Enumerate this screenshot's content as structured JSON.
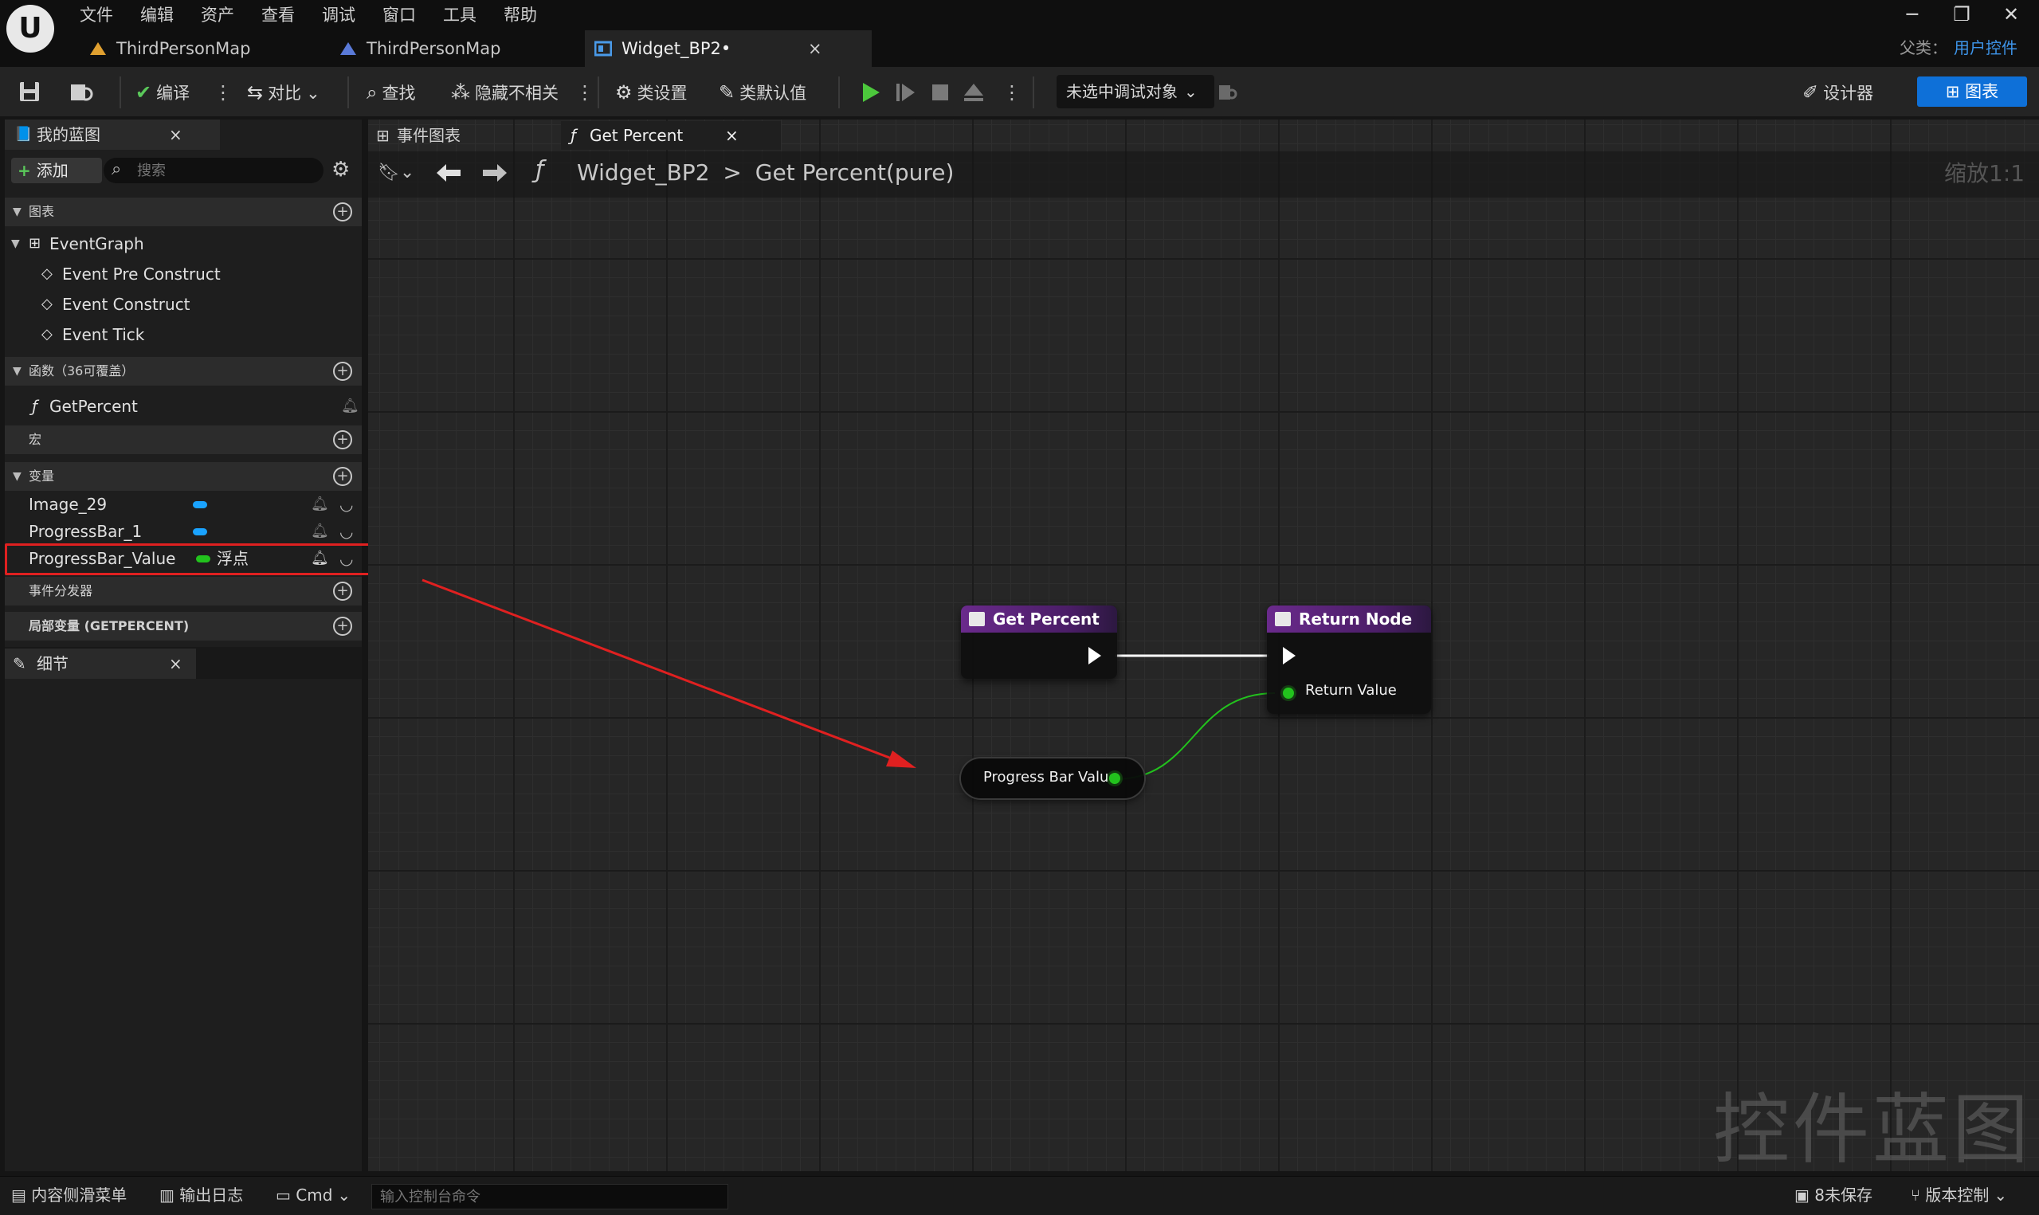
{
  "menu": [
    "文件",
    "编辑",
    "资产",
    "查看",
    "调试",
    "窗口",
    "工具",
    "帮助"
  ],
  "tabs": [
    {
      "label": "ThirdPersonMap"
    },
    {
      "label": "ThirdPersonMap"
    },
    {
      "label": "Widget_BP2•",
      "close": "×"
    }
  ],
  "window": {
    "minimize": "─",
    "restore": "❐",
    "close": "✕"
  },
  "parent_class": {
    "label": "父类：",
    "value": "用户控件"
  },
  "toolbar": {
    "compile": "编译",
    "diff": "对比",
    "find": "查找",
    "hide_unrelated": "隐藏不相关",
    "class_settings": "类设置",
    "class_defaults": "类默认值",
    "debug_select": "未选中调试对象",
    "designer": "设计器",
    "graph": "图表"
  },
  "my_blueprint": {
    "tab_label": "我的蓝图",
    "close": "×",
    "add_label": "添加",
    "search_placeholder": "搜索",
    "sections": {
      "graphs": "图表",
      "functions": "函数（36可覆盖）",
      "macros": "宏",
      "variables": "变量",
      "dispatchers": "事件分发器",
      "locals": "局部变量 (GETPERCENT)"
    },
    "graph_items": [
      "EventGraph",
      "Event Pre Construct",
      "Event Construct",
      "Event Tick"
    ],
    "function_items": [
      "GetPercent"
    ],
    "variables": [
      {
        "name": "Image_29",
        "color": "#1aa3ff",
        "type": ""
      },
      {
        "name": "ProgressBar_1",
        "color": "#1aa3ff",
        "type": ""
      },
      {
        "name": "ProgressBar_Value",
        "color": "#22c21d",
        "type": "浮点"
      }
    ]
  },
  "details": {
    "tab_label": "细节",
    "close": "×"
  },
  "graph_tabs": [
    {
      "label": "事件图表"
    },
    {
      "label": "Get Percent",
      "close": "×"
    }
  ],
  "breadcrumb": {
    "root": "Widget_BP2",
    "separator": ">",
    "current": "Get Percent(pure)"
  },
  "zoom_label": "缩放1:1",
  "watermark": "控件蓝图",
  "nodes": {
    "get_percent": "Get Percent",
    "return_node": "Return Node",
    "return_value": "Return Value",
    "progress_bar_value": "Progress Bar Value"
  },
  "statusbar": {
    "content_drawer": "内容侧滑菜单",
    "output_log": "输出日志",
    "cmd": "Cmd",
    "console_placeholder": "输入控制台命令",
    "unsaved": "8未保存",
    "source_control": "版本控制"
  },
  "colors": {
    "accent": "#0e70d8",
    "highlight_box": "#e02020",
    "float_pin": "#22c21d",
    "object_pin": "#1aa3ff"
  }
}
